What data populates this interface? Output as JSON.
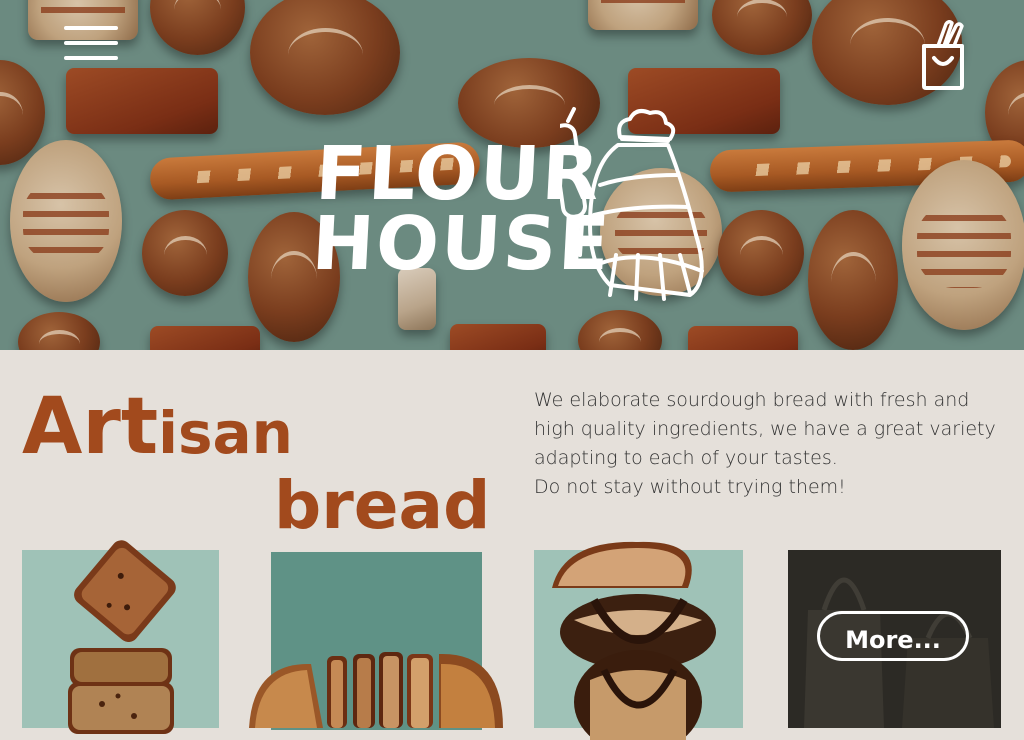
{
  "header": {
    "brand_line1": "FLOUR",
    "brand_line2": "HOUSE"
  },
  "icons": {
    "menu": "hamburger-menu-icon",
    "cart": "shopping-bag-icon",
    "mascot": "chef-bread-mascot-icon"
  },
  "hero": {
    "title_part1_big": "Art",
    "title_part1_small": "isan",
    "title_part2": "bread",
    "description_line1": "We elaborate sourdough bread with fresh and",
    "description_line2": "high quality ingredients, we have a great variety",
    "description_line3": "adapting to each of your tastes.",
    "description_line4": "Do not stay without trying them!"
  },
  "gallery": {
    "more_label": "More..."
  },
  "colors": {
    "hero_bg": "#6b8a80",
    "page_bg": "#e5e0da",
    "accent_brown": "#a24a1d",
    "card_mint": "#9fc2b7",
    "card_teal": "#5f9286",
    "card_dark": "#2c2a25"
  }
}
